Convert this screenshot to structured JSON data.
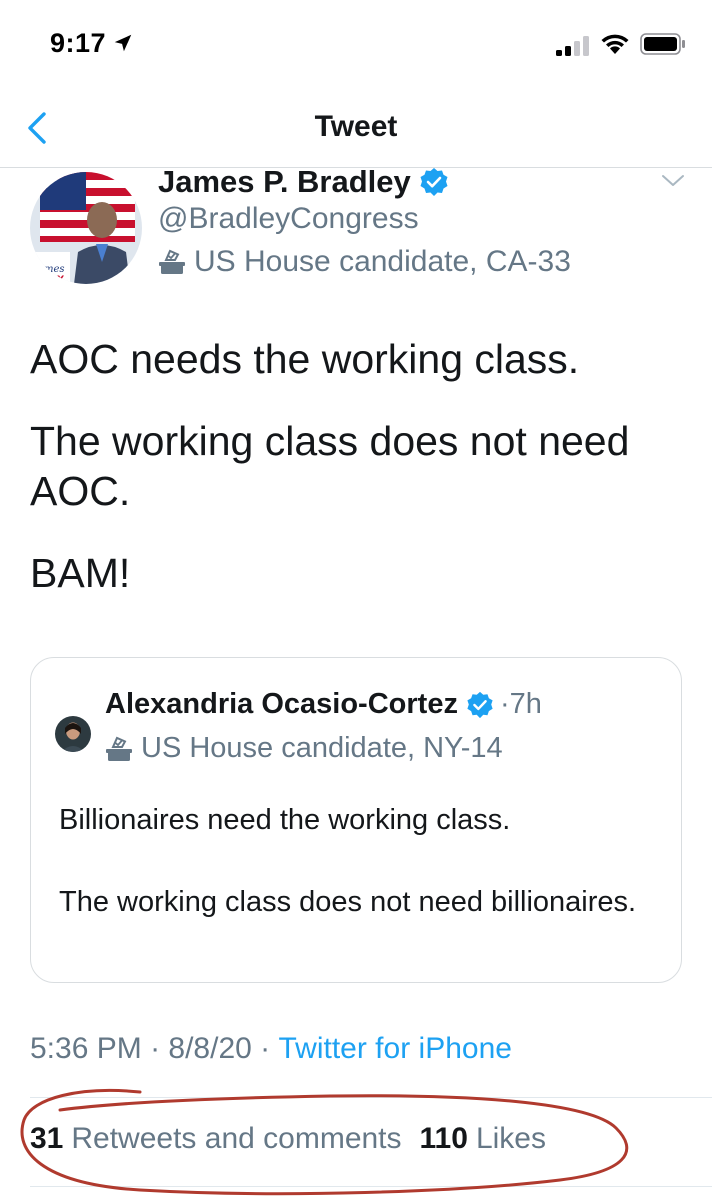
{
  "status_bar": {
    "time": "9:17"
  },
  "nav": {
    "title": "Tweet"
  },
  "tweet": {
    "author_name": "James P. Bradley",
    "author_handle": "@BradleyCongress",
    "author_label": "US House candidate, CA-33",
    "body": [
      "AOC needs the working class.",
      "The working class does not need AOC.",
      "BAM!"
    ],
    "quoted": {
      "author_name": "Alexandria Ocasio-Cortez",
      "time": "7h",
      "author_label": "US House candidate, NY-14",
      "paragraphs": [
        "Billionaires need the working class.",
        "The working class does not need billionaires."
      ]
    },
    "meta": {
      "time": "5:36 PM",
      "date": "8/8/20",
      "source": "Twitter for iPhone"
    },
    "stats": {
      "retweets_count": "31",
      "retweets_label": "Retweets and comments",
      "likes_count": "110",
      "likes_label": "Likes"
    }
  },
  "colors": {
    "accent": "#1da1f2",
    "secondary_text": "#657786",
    "verified": "#1da1f2",
    "annotation": "#b03a2e"
  }
}
